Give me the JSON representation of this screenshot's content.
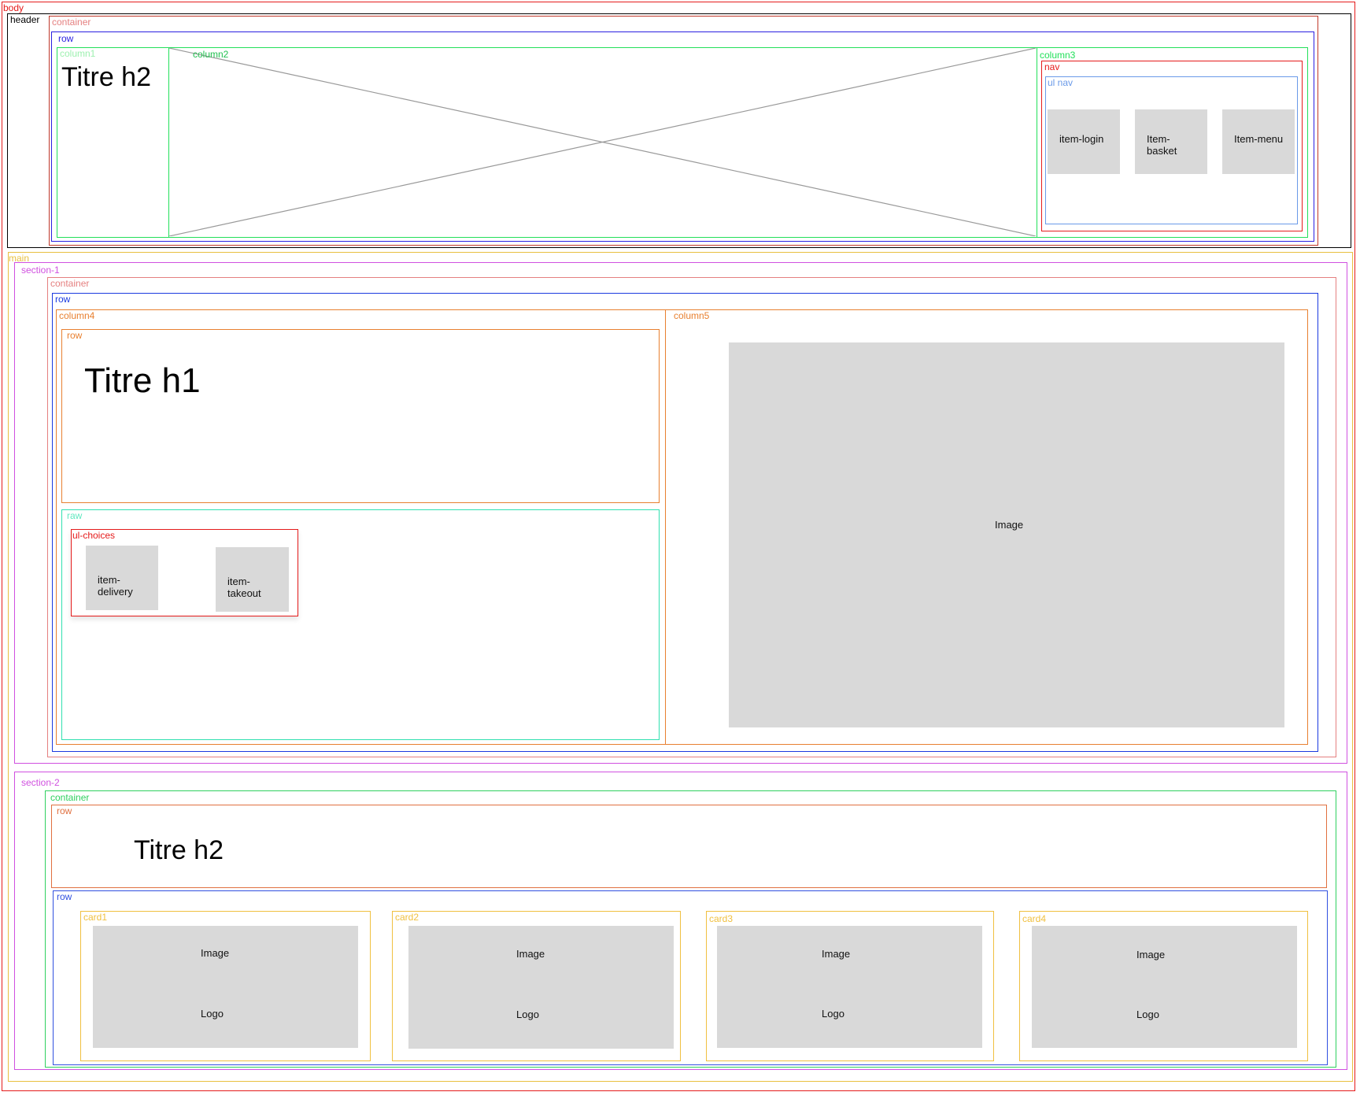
{
  "labels": {
    "body": "body",
    "header": "header",
    "header_container": "container",
    "header_row": "row",
    "column1": "column1",
    "column2": "column2",
    "column3": "column3",
    "nav": "nav",
    "ul_nav": "ul nav",
    "main": "main",
    "section1": "section-1",
    "s1_container": "container",
    "s1_row": "row",
    "column4": "column4",
    "s1_inner_row": "row",
    "raw": "raw",
    "ul_choices": "ul-choices",
    "column5": "column5",
    "section2": "section-2",
    "s2_container": "container",
    "s2_row": "row",
    "s2_cards_row": "row"
  },
  "header": {
    "title": "Titre h2",
    "nav_items": [
      "item-login",
      "Item-\nbasket",
      "Item-menu"
    ]
  },
  "section1": {
    "title": "Titre h1",
    "choices": [
      "item-\ndelivery",
      "item-\ntakeout"
    ],
    "image_label": "Image"
  },
  "section2": {
    "title": "Titre h2",
    "cards": [
      {
        "label": "card1",
        "image": "Image",
        "logo": "Logo"
      },
      {
        "label": "card2",
        "image": "Image",
        "logo": "Logo"
      },
      {
        "label": "card3",
        "image": "Image",
        "logo": "Logo"
      },
      {
        "label": "card4",
        "image": "Image",
        "logo": "Logo"
      }
    ]
  }
}
